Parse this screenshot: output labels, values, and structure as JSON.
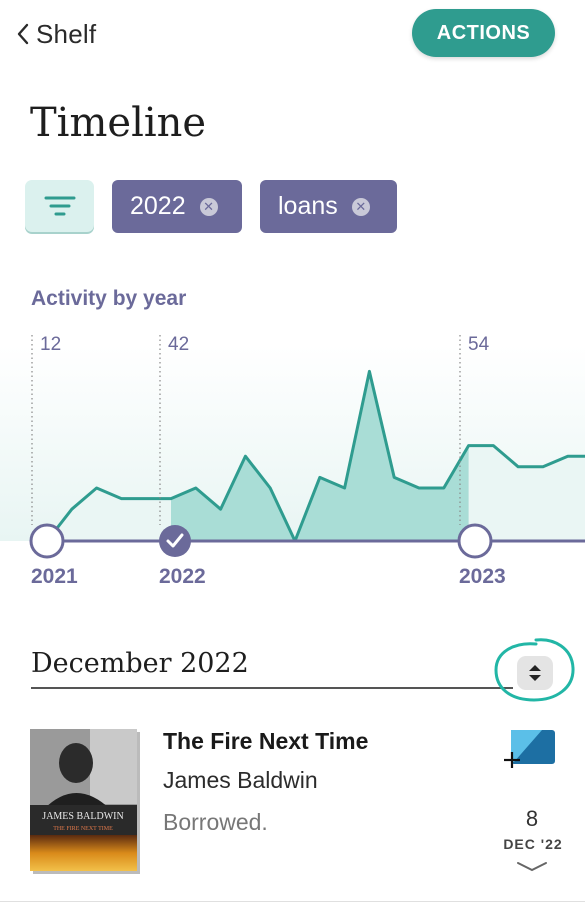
{
  "nav": {
    "back_label": "Shelf",
    "actions_label": "ACTIONS"
  },
  "page": {
    "title": "Timeline"
  },
  "filters": {
    "chips": [
      {
        "label": "2022",
        "remove_icon": "close-icon"
      },
      {
        "label": "loans",
        "remove_icon": "close-icon"
      }
    ],
    "filter_icon": "filter-lines-icon"
  },
  "chart": {
    "title": "Activity by year",
    "accent": "#2f9c8f",
    "fill": "#a9ddd6",
    "fill_light": "#eaf6f4",
    "axis_color": "#6b6a9a"
  },
  "chart_data": {
    "type": "area",
    "title": "Activity by year",
    "years": [
      {
        "label": "2021",
        "count": "12",
        "selected": false
      },
      {
        "label": "2022",
        "count": "42",
        "selected": true
      },
      {
        "label": "2023",
        "count": "54",
        "selected": false
      }
    ],
    "x": [
      0,
      1,
      2,
      3,
      4,
      5,
      6,
      7,
      8,
      9,
      10,
      11,
      12,
      13,
      14,
      15,
      16,
      17,
      18,
      19,
      20,
      21
    ],
    "values": [
      0,
      3,
      5,
      4,
      4,
      4,
      5,
      3,
      8,
      5,
      0,
      6,
      5,
      16,
      6,
      5,
      5,
      9,
      9,
      7,
      7,
      8
    ],
    "year_start_index": [
      0,
      5,
      17
    ],
    "highlighted_range": [
      5,
      17
    ]
  },
  "section": {
    "month": "December 2022",
    "sort_icon": "sort-toggle-icon"
  },
  "book": {
    "title": "The Fire Next Time",
    "author": "James Baldwin",
    "status": "Borrowed.",
    "cover_author": "JAMES BALDWIN",
    "cover_title": "THE FIRE NEXT TIME",
    "date_day": "8",
    "date_month": "DEC '22",
    "add_icon": "add-to-list-icon",
    "expand_icon": "chevron-down-icon"
  }
}
